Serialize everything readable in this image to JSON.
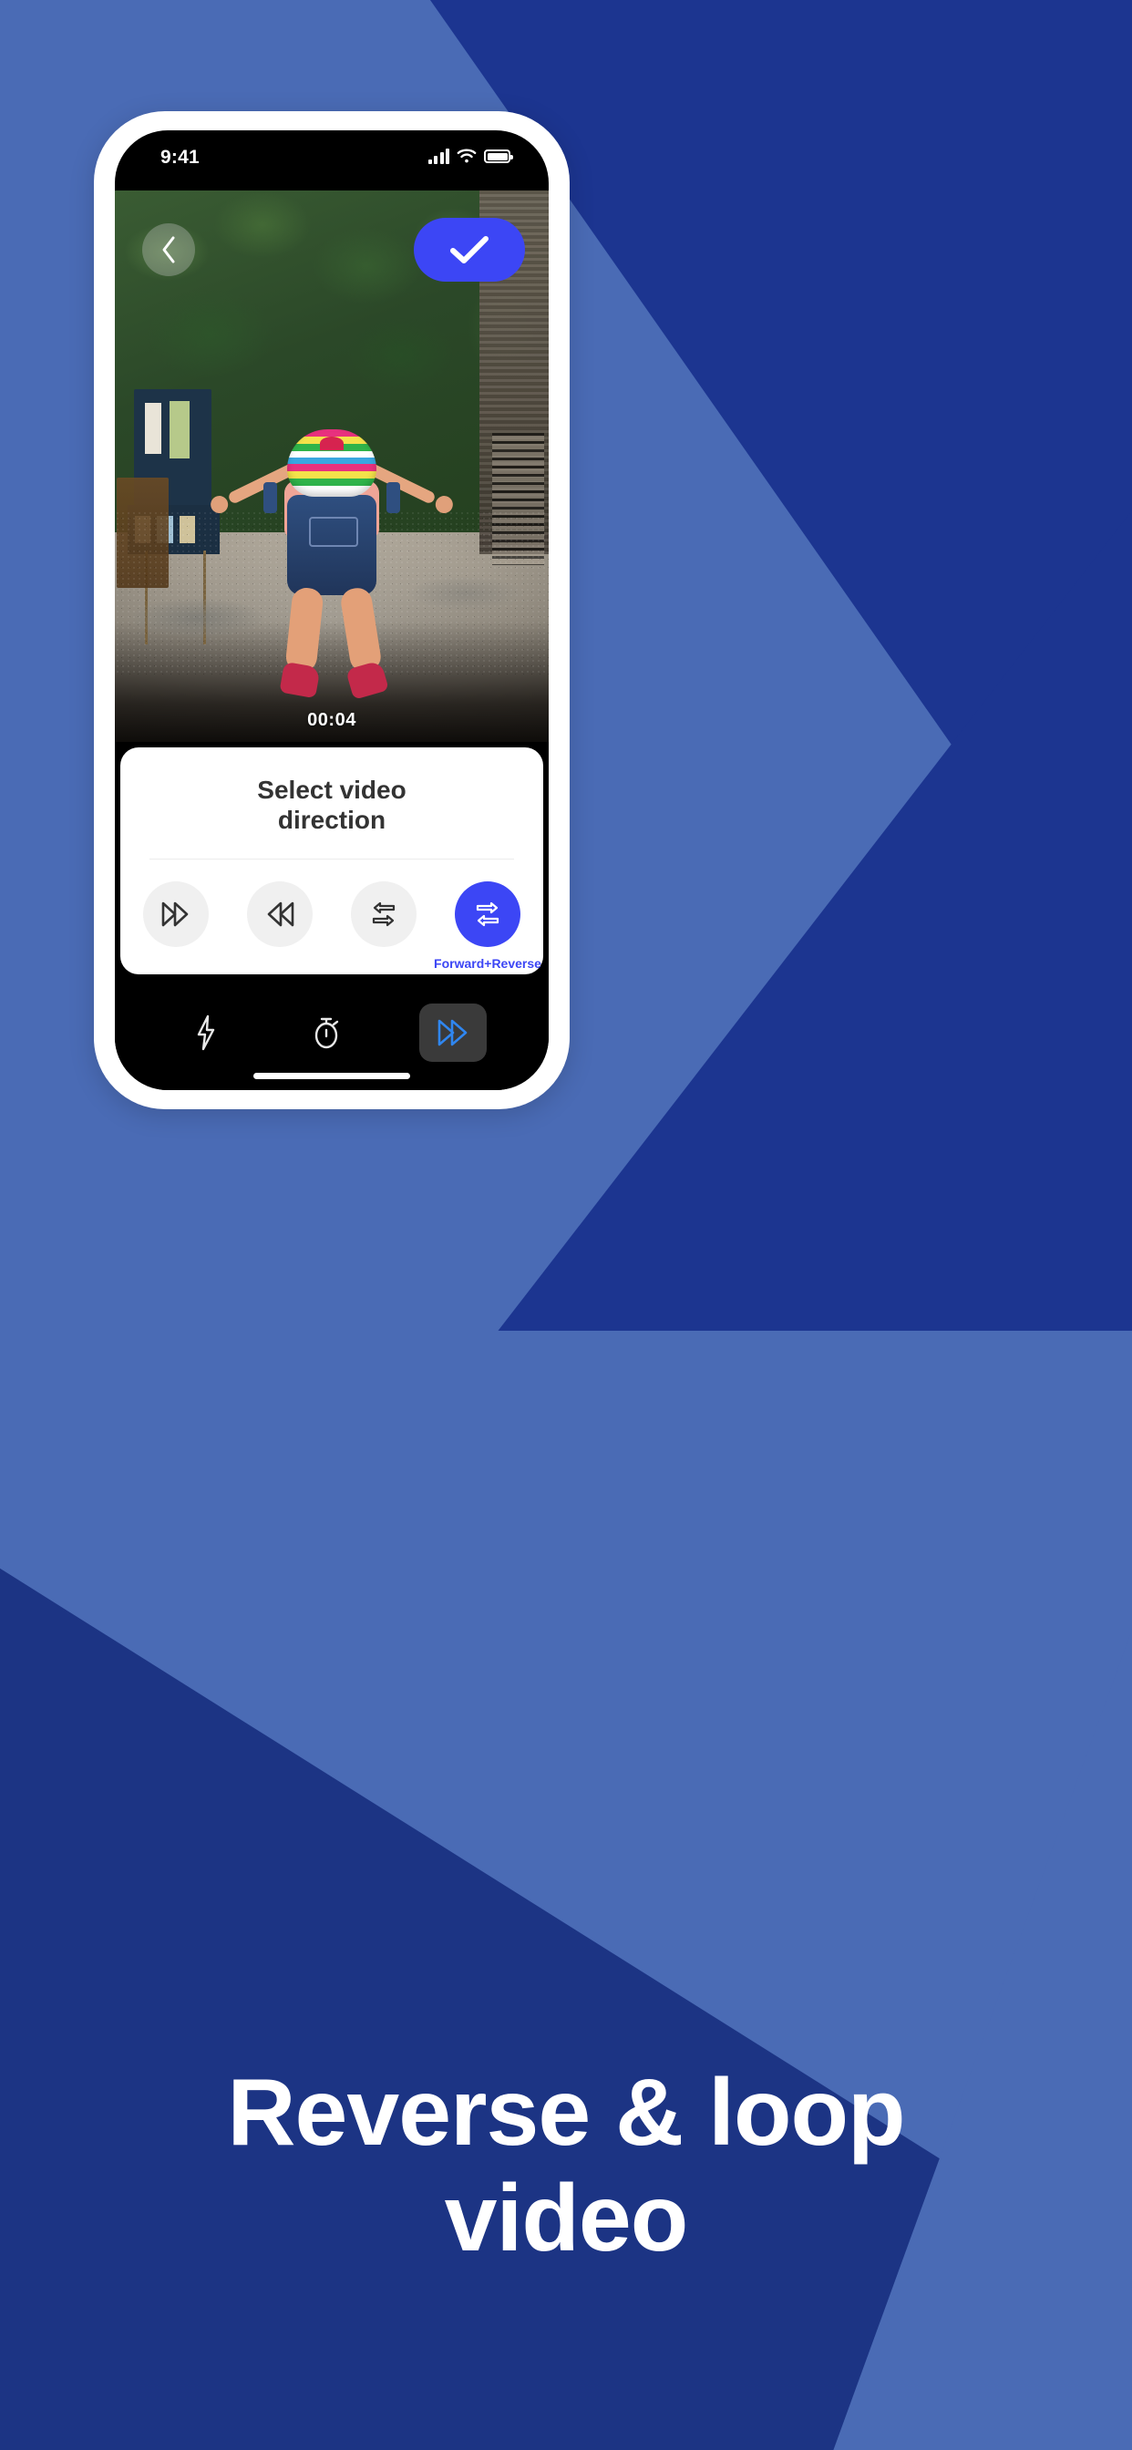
{
  "background": {
    "light_blue": "#4a6bb5",
    "navy": "#1c3590",
    "deep_navy": "#1c3484"
  },
  "status_bar": {
    "time": "9:41",
    "signal_icon": "cellular-signal-icon",
    "wifi_icon": "wifi-icon",
    "battery_icon": "battery-icon"
  },
  "video": {
    "back_icon": "chevron-left-icon",
    "confirm_icon": "checkmark-icon",
    "timestamp": "00:04"
  },
  "sheet": {
    "title": "Select video\ndirection",
    "title_line1": "Select video",
    "title_line2": "direction",
    "options": [
      {
        "name": "forward",
        "icon": "double-chevron-right-icon",
        "label": "",
        "selected": false
      },
      {
        "name": "reverse",
        "icon": "double-chevron-left-icon",
        "label": "",
        "selected": false
      },
      {
        "name": "reverse-forward",
        "icon": "swap-arrows-left-top-icon",
        "label": "",
        "selected": false
      },
      {
        "name": "forward-reverse",
        "icon": "swap-arrows-right-top-icon",
        "label": "Forward+Reverse",
        "selected": true
      }
    ],
    "selected_label": "Forward+Reverse",
    "accent_color": "#3c46f5"
  },
  "toolbar": {
    "items": [
      {
        "name": "flash",
        "icon": "lightning-bolt-icon",
        "active": false
      },
      {
        "name": "timer",
        "icon": "stopwatch-icon",
        "active": false
      },
      {
        "name": "speed",
        "icon": "fast-forward-icon",
        "active": true
      }
    ],
    "active_icon_color": "#2f86f0"
  },
  "headline": {
    "text": "Reverse & loop video",
    "line1": "Reverse & loop",
    "line2": "video",
    "color": "#ffffff"
  }
}
